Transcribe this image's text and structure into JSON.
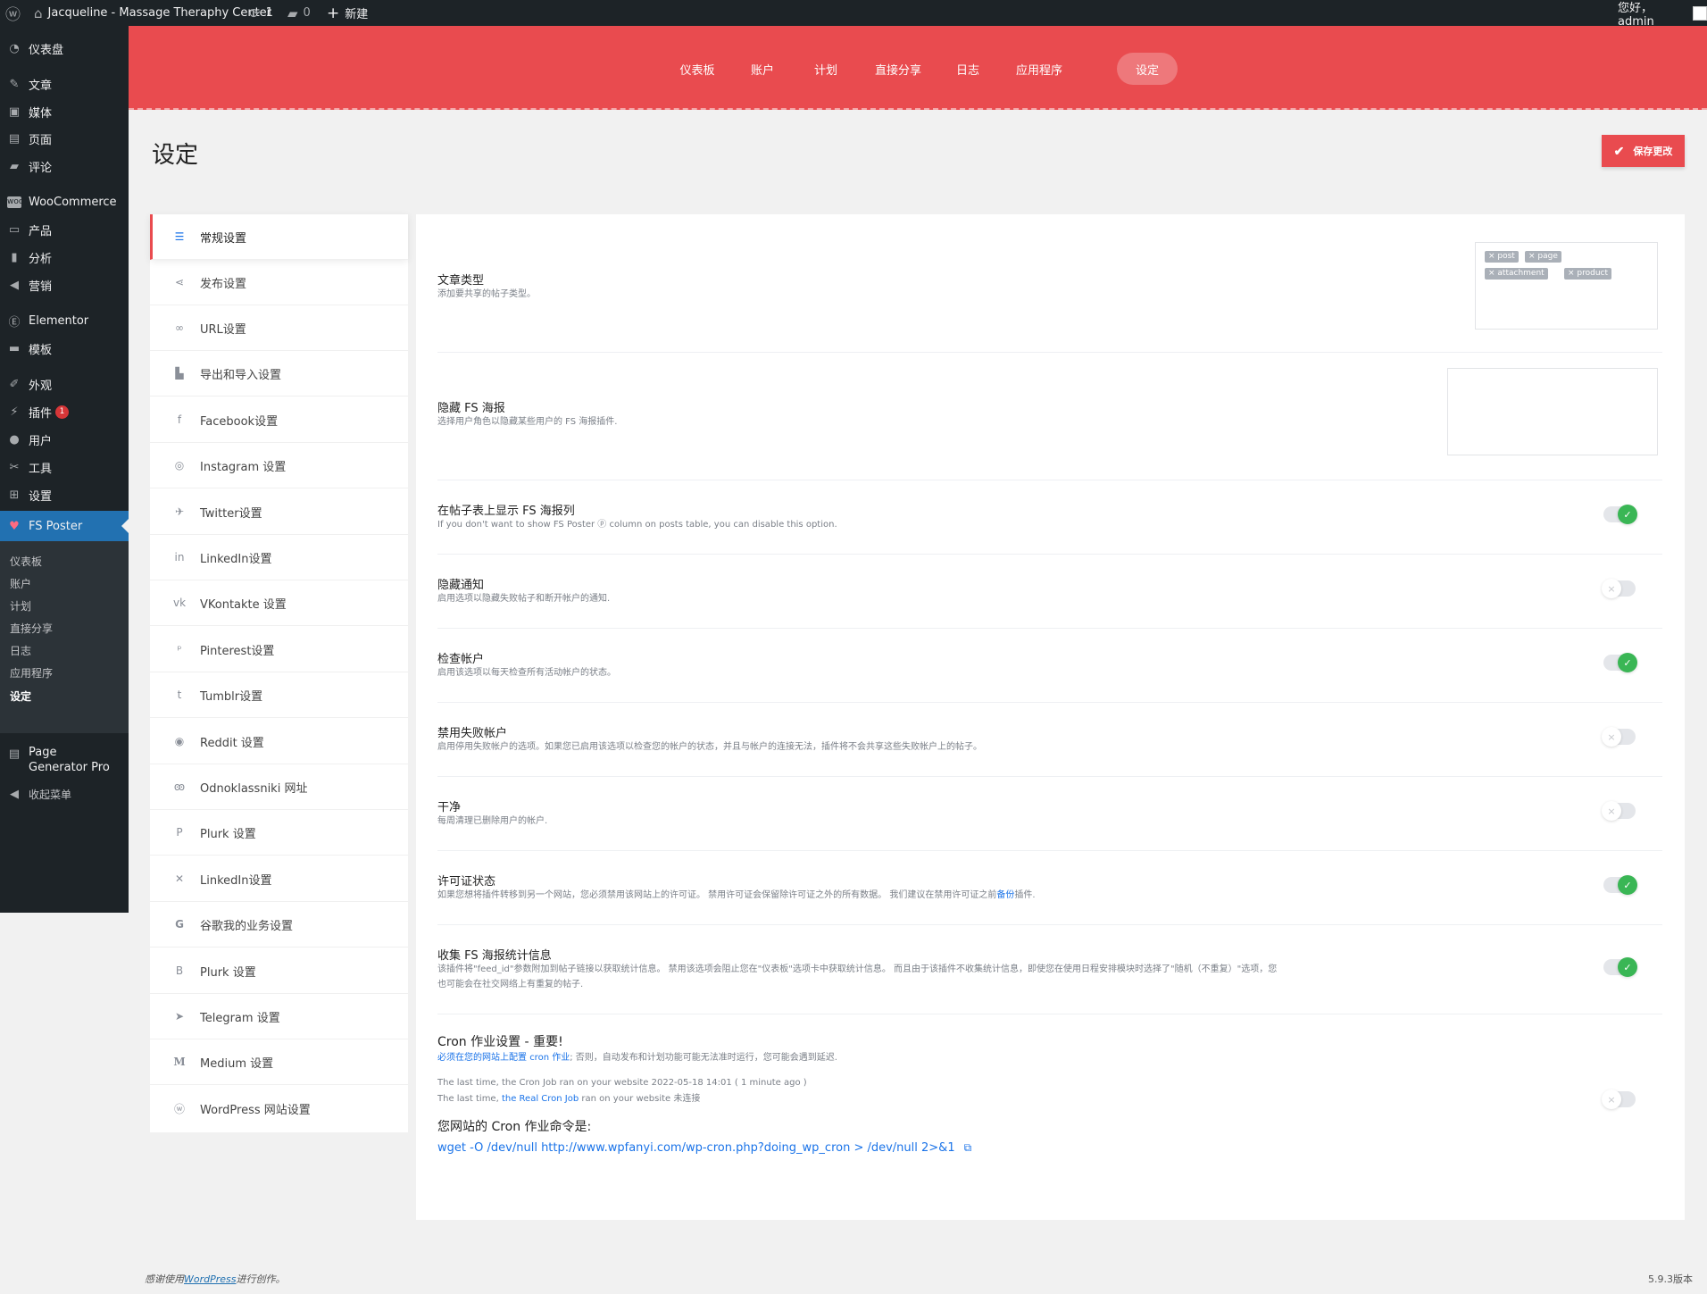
{
  "adminbar": {
    "site_name": "Jacqueline - Massage Theraphy Center",
    "updates_count": "1",
    "comments_count": "0",
    "new_label": "新建",
    "greeting": "您好，admin"
  },
  "sidebar": {
    "items": [
      {
        "label": "仪表盘",
        "icon": "dashboard-icon"
      },
      {
        "label": "文章",
        "icon": "pin-icon"
      },
      {
        "label": "媒体",
        "icon": "media-icon"
      },
      {
        "label": "页面",
        "icon": "page-icon"
      },
      {
        "label": "评论",
        "icon": "comment-icon"
      },
      {
        "label": "WooCommerce",
        "icon": "woo-icon"
      },
      {
        "label": "产品",
        "icon": "product-icon"
      },
      {
        "label": "分析",
        "icon": "chart-icon"
      },
      {
        "label": "营销",
        "icon": "megaphone-icon"
      },
      {
        "label": "Elementor",
        "icon": "elementor-icon"
      },
      {
        "label": "模板",
        "icon": "folder-icon"
      },
      {
        "label": "外观",
        "icon": "brush-icon"
      },
      {
        "label": "插件",
        "icon": "plugin-icon",
        "badge": "1"
      },
      {
        "label": "用户",
        "icon": "user-icon"
      },
      {
        "label": "工具",
        "icon": "wrench-icon"
      },
      {
        "label": "设置",
        "icon": "settings-icon"
      },
      {
        "label": "FS Poster",
        "icon": "fs-poster-icon"
      },
      {
        "label": "Page Generator Pro",
        "icon": "page-generator-icon"
      },
      {
        "label": "收起菜单",
        "icon": "collapse-icon"
      }
    ],
    "submenu": [
      "仪表板",
      "账户",
      "计划",
      "直接分享",
      "日志",
      "应用程序",
      "设定"
    ]
  },
  "topnav": {
    "tabs": [
      "仪表板",
      "账户",
      "计划",
      "直接分享",
      "日志",
      "应用程序",
      "设定"
    ],
    "active": "设定"
  },
  "page": {
    "title": "设定",
    "save_label": "保存更改"
  },
  "settings_menu": [
    {
      "label": "常规设置",
      "icon": "sliders-icon"
    },
    {
      "label": "发布设置",
      "icon": "share-icon"
    },
    {
      "label": "URL设置",
      "icon": "link-icon"
    },
    {
      "label": "导出和导入设置",
      "icon": "file-export-icon"
    },
    {
      "label": "Facebook设置",
      "icon": "facebook-icon"
    },
    {
      "label": "Instagram 设置",
      "icon": "instagram-icon"
    },
    {
      "label": "Twitter设置",
      "icon": "twitter-icon"
    },
    {
      "label": "LinkedIn设置",
      "icon": "linkedin-icon"
    },
    {
      "label": "VKontakte 设置",
      "icon": "vk-icon"
    },
    {
      "label": "Pinterest设置",
      "icon": "pinterest-icon"
    },
    {
      "label": "Tumblr设置",
      "icon": "tumblr-icon"
    },
    {
      "label": "Reddit 设置",
      "icon": "reddit-icon"
    },
    {
      "label": "Odnoklassniki 网址",
      "icon": "odnoklassniki-icon"
    },
    {
      "label": "Plurk 设置",
      "icon": "plurk-icon"
    },
    {
      "label": "LinkedIn设置",
      "icon": "xing-icon"
    },
    {
      "label": "谷歌我的业务设置",
      "icon": "google-icon"
    },
    {
      "label": "Plurk 设置",
      "icon": "blogger-icon"
    },
    {
      "label": "Telegram 设置",
      "icon": "telegram-icon"
    },
    {
      "label": "Medium 设置",
      "icon": "medium-icon"
    },
    {
      "label": "WordPress 网站设置",
      "icon": "wordpress-icon"
    }
  ],
  "settings": {
    "post_types": {
      "title": "文章类型",
      "desc": "添加要共享的帖子类型。",
      "tags": [
        "× post",
        "× page",
        "× attachment",
        "× product"
      ]
    },
    "hide_poster": {
      "title": "隐藏 FS 海报",
      "desc": "选择用户角色以隐藏某些用户的 FS 海报插件."
    },
    "show_column": {
      "title": "在帖子表上显示 FS 海报列",
      "desc": "If you don't want to show FS Poster ⓟ column on posts table, you can disable this option.",
      "enabled": true
    },
    "hide_notifications": {
      "title": "隐藏通知",
      "desc": "启用选项以隐藏失败帖子和断开帐户的通知.",
      "enabled": false
    },
    "check_accounts": {
      "title": "检查帐户",
      "desc": "启用该选项以每天检查所有活动帐户的状态。",
      "enabled": true
    },
    "disable_failed": {
      "title": "禁用失败帐户",
      "desc": "启用停用失败帐户的选项。如果您已启用该选项以检查您的帐户的状态，并且与帐户的连接无法，插件将不会共享这些失败帐户上的帖子。",
      "enabled": false
    },
    "clean": {
      "title": "干净",
      "desc": "每周清理已删除用户的帐户.",
      "enabled": false
    },
    "license": {
      "title": "许可证状态",
      "desc_before": "如果您想将插件转移到另一个网站，您必须禁用该网站上的许可证。 禁用许可证会保留除许可证之外的所有数据。 我们建议在禁用许可证之前",
      "desc_link": "备份",
      "desc_after": "插件.",
      "enabled": true
    },
    "collect_stats": {
      "title": "收集 FS 海报统计信息",
      "desc": "该插件将\"feed_id\"参数附加到帖子链接以获取统计信息。 禁用该选项会阻止您在\"仪表板\"选项卡中获取统计信息。 而且由于该插件不收集统计信息，即使您在使用日程安排模块时选择了\"随机（不重复）\"选项，您也可能会在社交网络上有重复的帖子.",
      "enabled": true
    },
    "cron": {
      "title": "Cron 作业设置 - 重要!",
      "desc_link1": "必须在您的网站上配置",
      "desc_link2": "cron 作业",
      "desc_rest": "; 否则，自动发布和计划功能可能无法准时运行，您可能会遇到延迟.",
      "last_run": "The last time, the Cron Job ran on your website 2022-05-18 14:01 ( 1 minute ago )",
      "real_before": "The last time,",
      "real_link": "the Real Cron Job",
      "real_after": "ran on your website 未连接",
      "command_label": "您网站的 Cron 作业命令是:",
      "command": "wget -O /dev/null http://www.wpfanyi.com/wp-cron.php?doing_wp_cron > /dev/null 2>&1",
      "enabled": false
    }
  },
  "footer": {
    "thanks_before": "感谢使用",
    "thanks_link": "WordPress",
    "thanks_after": "进行创作。",
    "version": "5.9.3版本"
  },
  "colors": {
    "accent": "#e94b4f",
    "wp_dark": "#1d2327",
    "wp_blue": "#2271b1",
    "toggle_on": "#3ab655",
    "link": "#1a73e8"
  }
}
